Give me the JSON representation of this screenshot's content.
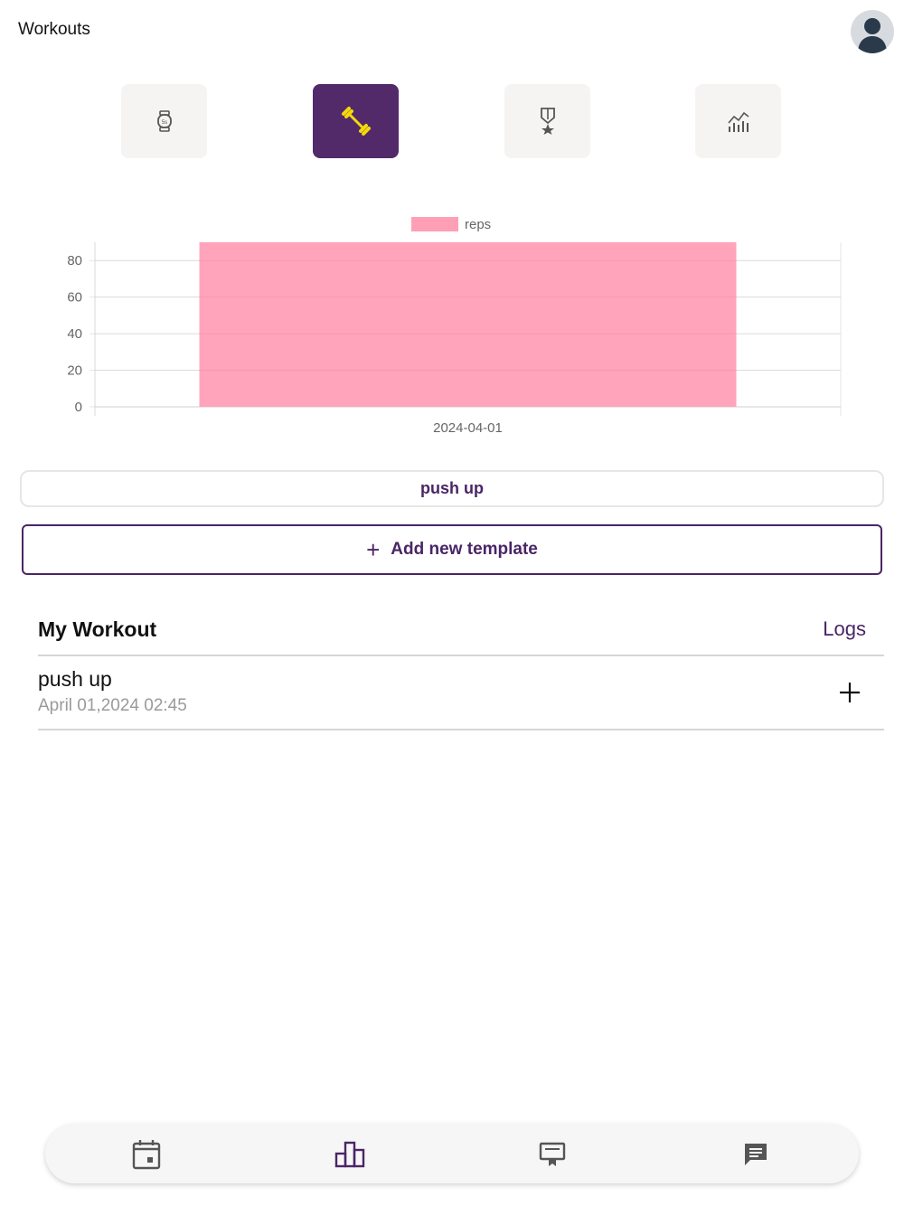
{
  "header": {
    "title": "Workouts"
  },
  "icon_tabs": [
    {
      "name": "watch-icon",
      "active": false
    },
    {
      "name": "dumbbell-icon",
      "active": true
    },
    {
      "name": "medal-icon",
      "active": false
    },
    {
      "name": "stats-chart-icon",
      "active": false
    }
  ],
  "chart_data": {
    "type": "bar",
    "categories": [
      "2024-04-01"
    ],
    "series": [
      {
        "name": "reps",
        "values": [
          90
        ],
        "color": "#ff9fb6"
      }
    ],
    "yticks": [
      "0",
      "20",
      "40",
      "60",
      "80"
    ],
    "ylim": [
      0,
      90
    ],
    "grid": true,
    "legend": "top-center"
  },
  "exercise_selector": {
    "label": "push up"
  },
  "add_template": {
    "label": "Add new template",
    "icon": "plus-icon"
  },
  "my_workout": {
    "title": "My Workout",
    "logs_label": "Logs",
    "items": [
      {
        "name": "push up",
        "date": "April 01,2024 02:45"
      }
    ]
  },
  "bottom_nav": [
    {
      "name": "calendar-icon"
    },
    {
      "name": "podium-icon",
      "active": true
    },
    {
      "name": "certificate-icon"
    },
    {
      "name": "chat-icon"
    }
  ],
  "colors": {
    "accent": "#522a6a",
    "bar": "#ff9fb6",
    "icon_highlight": "#f5d90a"
  }
}
